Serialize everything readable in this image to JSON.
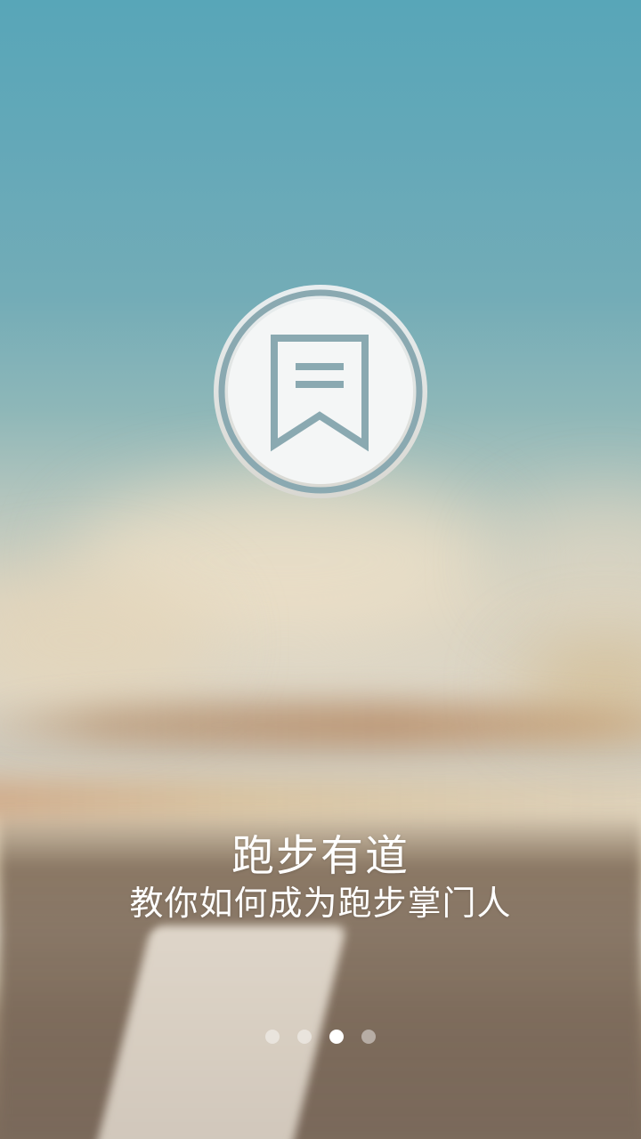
{
  "splash": {
    "title": "跑步有道",
    "subtitle": "教你如何成为跑步掌门人"
  },
  "logo": {
    "icon": "bookmark-icon",
    "accent_color": "#8aa9b1"
  },
  "pager": {
    "total": 4,
    "active_index": 2
  }
}
